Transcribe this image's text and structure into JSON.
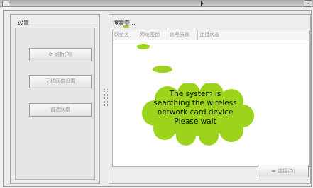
{
  "window": {
    "title": ""
  },
  "left": {
    "title": "设置",
    "buttons": {
      "refresh": {
        "icon": "⟳",
        "label": "刷新(R)"
      },
      "wifi_settings": {
        "label": "无线网络设置"
      },
      "preferred": {
        "label": "首选网络"
      }
    }
  },
  "right": {
    "status": "搜索中...",
    "columns": [
      "网络名",
      "网络密钥",
      "信号质量",
      "连接状态"
    ],
    "connect": {
      "icon": "◂▸",
      "label": "连接(O)"
    }
  },
  "callout": {
    "lines": [
      "The system is",
      "searching the wireless",
      "network card device",
      "Please wait"
    ]
  },
  "colors": {
    "callout": "#9bd41b"
  }
}
